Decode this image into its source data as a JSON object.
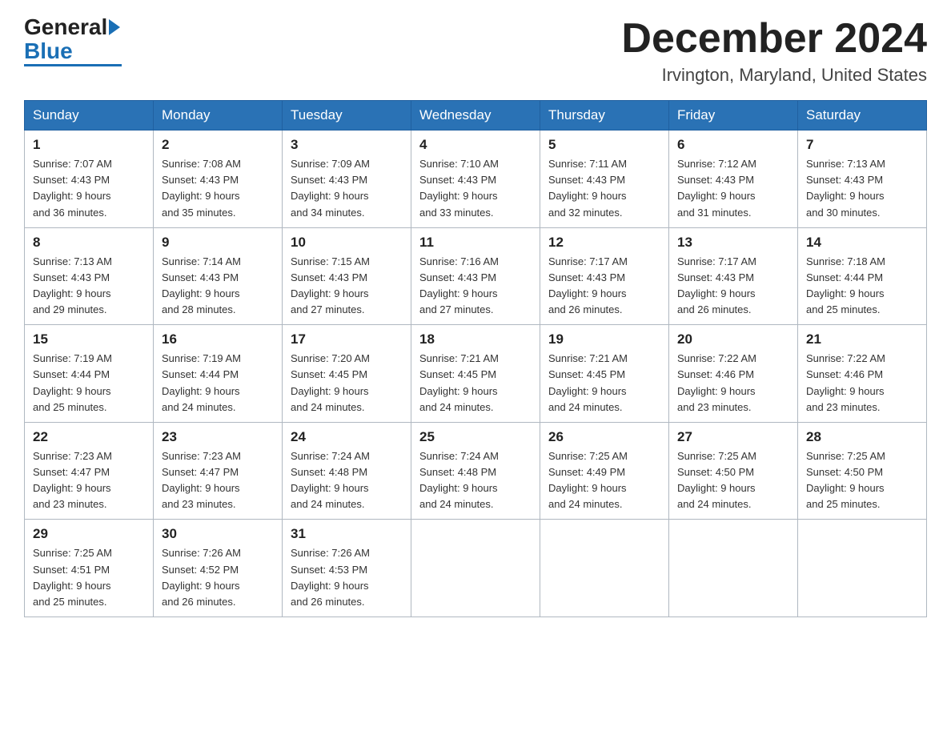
{
  "header": {
    "logo_general": "General",
    "logo_blue": "Blue",
    "month_title": "December 2024",
    "location": "Irvington, Maryland, United States"
  },
  "weekdays": [
    "Sunday",
    "Monday",
    "Tuesday",
    "Wednesday",
    "Thursday",
    "Friday",
    "Saturday"
  ],
  "weeks": [
    [
      {
        "day": "1",
        "sunrise": "7:07 AM",
        "sunset": "4:43 PM",
        "daylight": "9 hours and 36 minutes."
      },
      {
        "day": "2",
        "sunrise": "7:08 AM",
        "sunset": "4:43 PM",
        "daylight": "9 hours and 35 minutes."
      },
      {
        "day": "3",
        "sunrise": "7:09 AM",
        "sunset": "4:43 PM",
        "daylight": "9 hours and 34 minutes."
      },
      {
        "day": "4",
        "sunrise": "7:10 AM",
        "sunset": "4:43 PM",
        "daylight": "9 hours and 33 minutes."
      },
      {
        "day": "5",
        "sunrise": "7:11 AM",
        "sunset": "4:43 PM",
        "daylight": "9 hours and 32 minutes."
      },
      {
        "day": "6",
        "sunrise": "7:12 AM",
        "sunset": "4:43 PM",
        "daylight": "9 hours and 31 minutes."
      },
      {
        "day": "7",
        "sunrise": "7:13 AM",
        "sunset": "4:43 PM",
        "daylight": "9 hours and 30 minutes."
      }
    ],
    [
      {
        "day": "8",
        "sunrise": "7:13 AM",
        "sunset": "4:43 PM",
        "daylight": "9 hours and 29 minutes."
      },
      {
        "day": "9",
        "sunrise": "7:14 AM",
        "sunset": "4:43 PM",
        "daylight": "9 hours and 28 minutes."
      },
      {
        "day": "10",
        "sunrise": "7:15 AM",
        "sunset": "4:43 PM",
        "daylight": "9 hours and 27 minutes."
      },
      {
        "day": "11",
        "sunrise": "7:16 AM",
        "sunset": "4:43 PM",
        "daylight": "9 hours and 27 minutes."
      },
      {
        "day": "12",
        "sunrise": "7:17 AM",
        "sunset": "4:43 PM",
        "daylight": "9 hours and 26 minutes."
      },
      {
        "day": "13",
        "sunrise": "7:17 AM",
        "sunset": "4:43 PM",
        "daylight": "9 hours and 26 minutes."
      },
      {
        "day": "14",
        "sunrise": "7:18 AM",
        "sunset": "4:44 PM",
        "daylight": "9 hours and 25 minutes."
      }
    ],
    [
      {
        "day": "15",
        "sunrise": "7:19 AM",
        "sunset": "4:44 PM",
        "daylight": "9 hours and 25 minutes."
      },
      {
        "day": "16",
        "sunrise": "7:19 AM",
        "sunset": "4:44 PM",
        "daylight": "9 hours and 24 minutes."
      },
      {
        "day": "17",
        "sunrise": "7:20 AM",
        "sunset": "4:45 PM",
        "daylight": "9 hours and 24 minutes."
      },
      {
        "day": "18",
        "sunrise": "7:21 AM",
        "sunset": "4:45 PM",
        "daylight": "9 hours and 24 minutes."
      },
      {
        "day": "19",
        "sunrise": "7:21 AM",
        "sunset": "4:45 PM",
        "daylight": "9 hours and 24 minutes."
      },
      {
        "day": "20",
        "sunrise": "7:22 AM",
        "sunset": "4:46 PM",
        "daylight": "9 hours and 23 minutes."
      },
      {
        "day": "21",
        "sunrise": "7:22 AM",
        "sunset": "4:46 PM",
        "daylight": "9 hours and 23 minutes."
      }
    ],
    [
      {
        "day": "22",
        "sunrise": "7:23 AM",
        "sunset": "4:47 PM",
        "daylight": "9 hours and 23 minutes."
      },
      {
        "day": "23",
        "sunrise": "7:23 AM",
        "sunset": "4:47 PM",
        "daylight": "9 hours and 23 minutes."
      },
      {
        "day": "24",
        "sunrise": "7:24 AM",
        "sunset": "4:48 PM",
        "daylight": "9 hours and 24 minutes."
      },
      {
        "day": "25",
        "sunrise": "7:24 AM",
        "sunset": "4:48 PM",
        "daylight": "9 hours and 24 minutes."
      },
      {
        "day": "26",
        "sunrise": "7:25 AM",
        "sunset": "4:49 PM",
        "daylight": "9 hours and 24 minutes."
      },
      {
        "day": "27",
        "sunrise": "7:25 AM",
        "sunset": "4:50 PM",
        "daylight": "9 hours and 24 minutes."
      },
      {
        "day": "28",
        "sunrise": "7:25 AM",
        "sunset": "4:50 PM",
        "daylight": "9 hours and 25 minutes."
      }
    ],
    [
      {
        "day": "29",
        "sunrise": "7:25 AM",
        "sunset": "4:51 PM",
        "daylight": "9 hours and 25 minutes."
      },
      {
        "day": "30",
        "sunrise": "7:26 AM",
        "sunset": "4:52 PM",
        "daylight": "9 hours and 26 minutes."
      },
      {
        "day": "31",
        "sunrise": "7:26 AM",
        "sunset": "4:53 PM",
        "daylight": "9 hours and 26 minutes."
      },
      null,
      null,
      null,
      null
    ]
  ],
  "labels": {
    "sunrise": "Sunrise:",
    "sunset": "Sunset:",
    "daylight": "Daylight:"
  }
}
